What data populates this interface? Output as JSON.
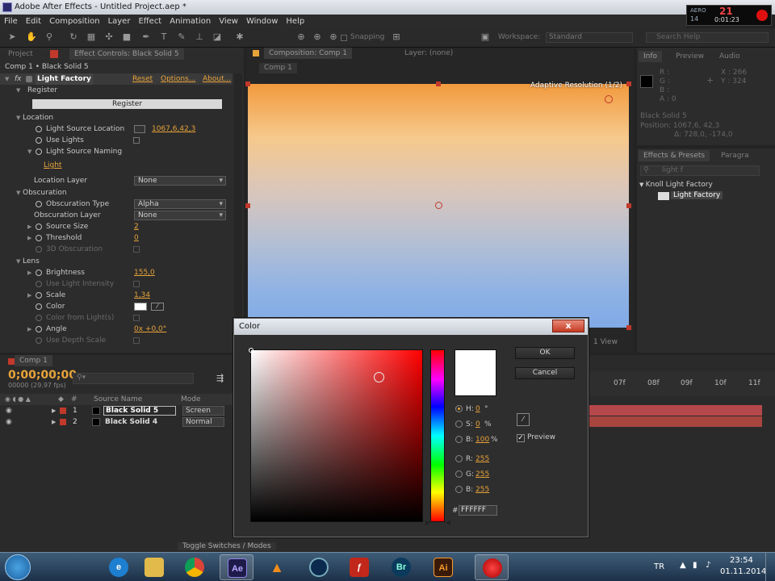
{
  "window": {
    "title": "Adobe After Effects - Untitled Project.aep *"
  },
  "menu": [
    "File",
    "Edit",
    "Composition",
    "Layer",
    "Effect",
    "Animation",
    "View",
    "Window",
    "Help"
  ],
  "toolbar": {
    "snapping_label": "Snapping",
    "workspace_label": "Workspace:",
    "workspace_value": "Standard",
    "search_placeholder": "Search Help"
  },
  "recorder": {
    "badge": "AERO",
    "badge_num": "14",
    "count": "21",
    "time": "0:01:23"
  },
  "project_panel": {
    "tab_project": "Project",
    "tab_effect_controls": "Effect Controls: Black Solid 5",
    "breadcrumb": "Comp 1 • Black Solid 5"
  },
  "effect": {
    "fx_label": "fx",
    "name": "Light Factory",
    "reset_label": "Reset",
    "options_label": "Options...",
    "about_label": "About...",
    "register_label": "Register",
    "register_button": "Register",
    "location_label": "Location",
    "light_source_location_label": "Light Source Location",
    "light_source_location_value": "1067,6,42,3",
    "use_lights_label": "Use Lights",
    "light_source_naming_label": "Light Source Naming",
    "light_source_naming_value": "Light",
    "location_layer_label": "Location Layer",
    "location_layer_value": "None",
    "obscuration_label": "Obscuration",
    "obscuration_type_label": "Obscuration Type",
    "obscuration_type_value": "Alpha",
    "obscuration_layer_label": "Obscuration Layer",
    "obscuration_layer_value": "None",
    "source_size_label": "Source Size",
    "source_size_value": "2",
    "threshold_label": "Threshold",
    "threshold_value": "0",
    "obscuration_3d_label": "3D Obscuration",
    "lens_label": "Lens",
    "brightness_label": "Brightness",
    "brightness_value": "155,0",
    "use_light_intensity_label": "Use Light Intensity",
    "scale_label": "Scale",
    "scale_value": "1,34",
    "color_label": "Color",
    "color_from_light_label": "Color from Light(s)",
    "angle_label": "Angle",
    "angle_value": "0x +0,0°",
    "use_depth_scale_label": "Use Depth Scale"
  },
  "composition_panel": {
    "tab_composition": "Composition: Comp 1",
    "tab_layer": "Layer: (none)",
    "comp_tab": "Comp 1",
    "adaptive_resolution": "Adaptive Resolution (1/2)",
    "view_label": "1 View"
  },
  "info_panel": {
    "tab_info": "Info",
    "tab_preview": "Preview",
    "tab_audio": "Audio",
    "r": "R :",
    "g": "G :",
    "b": "B :",
    "a": "A :  0",
    "x": "X : 266",
    "y": "Y : 324",
    "layer_name": "Black Solid 5",
    "position": "Position: 1067,6, 42,3",
    "delta": "Δ: 728,0, -174,0"
  },
  "effects_presets": {
    "tab": "Effects & Presets",
    "tab2": "Paragra",
    "search_value": "light f",
    "category": "Knoll Light Factory",
    "item": "Light Factory"
  },
  "timeline": {
    "tab": "Comp 1",
    "timecode": "0;00;00;00",
    "frames": "00000 (29.97 fps)",
    "col_source_name": "Source Name",
    "col_mode": "Mode",
    "toggle_label": "Toggle Switches / Modes",
    "ruler": [
      "07f",
      "08f",
      "09f",
      "10f",
      "11f"
    ],
    "layers": [
      {
        "num": "1",
        "name": "Black Solid 5",
        "mode": "Screen"
      },
      {
        "num": "2",
        "name": "Black Solid 4",
        "mode": "Normal"
      }
    ]
  },
  "color_dialog": {
    "title": "Color",
    "close": "x",
    "ok_label": "OK",
    "cancel_label": "Cancel",
    "preview_label": "Preview",
    "h_label": "H:",
    "h_value": "0",
    "h_unit": "°",
    "s_label": "S:",
    "s_value": "0",
    "s_unit": "%",
    "b_label": "B:",
    "b_value": "100",
    "b_unit": "%",
    "r_label": "R:",
    "r_value": "255",
    "g_label": "G:",
    "g_value": "255",
    "b2_label": "B:",
    "b2_value": "255",
    "hex_prefix": "#",
    "hex_value": "FFFFFF"
  },
  "taskbar": {
    "lang": "TR",
    "time": "23:54",
    "date": "01.11.2014"
  },
  "colors": {
    "accent": "#e8a33a",
    "selected_color": "#ffffff",
    "layer_red": "#c0392b"
  }
}
